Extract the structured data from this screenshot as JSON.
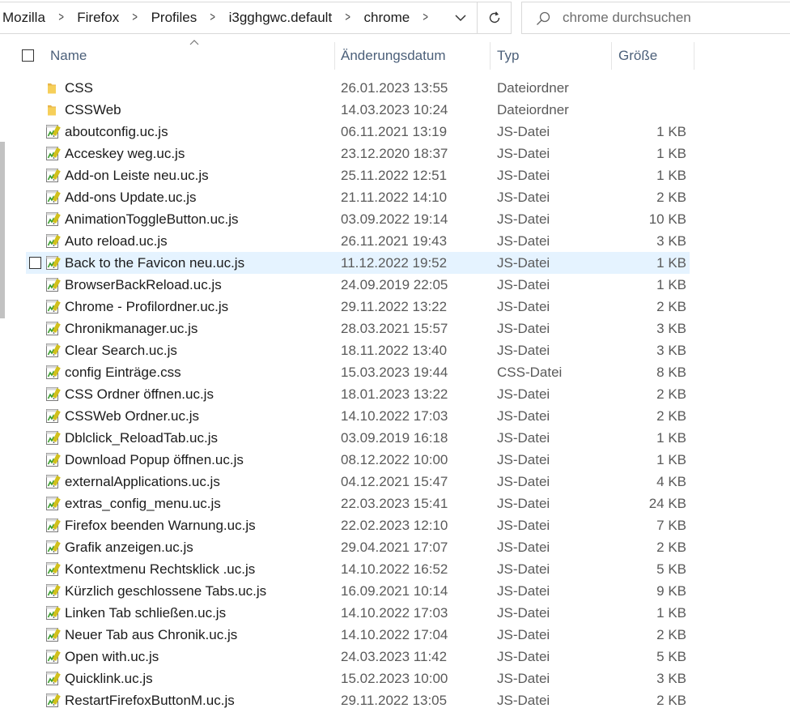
{
  "breadcrumb": [
    "Mozilla",
    "Firefox",
    "Profiles",
    "i3gghgwc.default",
    "chrome"
  ],
  "search": {
    "placeholder": "chrome durchsuchen"
  },
  "columns": {
    "name": "Name",
    "date": "Änderungsdatum",
    "type": "Typ",
    "size": "Größe"
  },
  "files": [
    {
      "name": "CSS",
      "date": "26.01.2023 13:55",
      "type": "Dateiordner",
      "size": "",
      "icon": "folder-icon"
    },
    {
      "name": "CSSWeb",
      "date": "14.03.2023 10:24",
      "type": "Dateiordner",
      "size": "",
      "icon": "folder-icon"
    },
    {
      "name": "aboutconfig.uc.js",
      "date": "06.11.2021 13:19",
      "type": "JS-Datei",
      "size": "1 KB",
      "icon": "script-file-icon"
    },
    {
      "name": "Acceskey weg.uc.js",
      "date": "23.12.2020 18:37",
      "type": "JS-Datei",
      "size": "1 KB",
      "icon": "script-file-icon"
    },
    {
      "name": "Add-on Leiste neu.uc.js",
      "date": "25.11.2022 12:51",
      "type": "JS-Datei",
      "size": "1 KB",
      "icon": "script-file-icon"
    },
    {
      "name": "Add-ons Update.uc.js",
      "date": "21.11.2022 14:10",
      "type": "JS-Datei",
      "size": "2 KB",
      "icon": "script-file-icon"
    },
    {
      "name": "AnimationToggleButton.uc.js",
      "date": "03.09.2022 19:14",
      "type": "JS-Datei",
      "size": "10 KB",
      "icon": "script-file-icon"
    },
    {
      "name": "Auto reload.uc.js",
      "date": "26.11.2021 19:43",
      "type": "JS-Datei",
      "size": "3 KB",
      "icon": "script-file-icon"
    },
    {
      "name": "Back to the Favicon neu.uc.js",
      "date": "11.12.2022 19:52",
      "type": "JS-Datei",
      "size": "1 KB",
      "icon": "script-file-icon",
      "hovered": true
    },
    {
      "name": "BrowserBackReload.uc.js",
      "date": "24.09.2019 22:05",
      "type": "JS-Datei",
      "size": "1 KB",
      "icon": "script-file-icon"
    },
    {
      "name": "Chrome - Profilordner.uc.js",
      "date": "29.11.2022 13:22",
      "type": "JS-Datei",
      "size": "2 KB",
      "icon": "script-file-icon"
    },
    {
      "name": "Chronikmanager.uc.js",
      "date": "28.03.2021 15:57",
      "type": "JS-Datei",
      "size": "3 KB",
      "icon": "script-file-icon"
    },
    {
      "name": "Clear Search.uc.js",
      "date": "18.11.2022 13:40",
      "type": "JS-Datei",
      "size": "3 KB",
      "icon": "script-file-icon"
    },
    {
      "name": "config Einträge.css",
      "date": "15.03.2023 19:44",
      "type": "CSS-Datei",
      "size": "8 KB",
      "icon": "script-file-icon"
    },
    {
      "name": "CSS Ordner öffnen.uc.js",
      "date": "18.01.2023 13:22",
      "type": "JS-Datei",
      "size": "2 KB",
      "icon": "script-file-icon"
    },
    {
      "name": "CSSWeb Ordner.uc.js",
      "date": "14.10.2022 17:03",
      "type": "JS-Datei",
      "size": "2 KB",
      "icon": "script-file-icon"
    },
    {
      "name": "Dblclick_ReloadTab.uc.js",
      "date": "03.09.2019 16:18",
      "type": "JS-Datei",
      "size": "1 KB",
      "icon": "script-file-icon"
    },
    {
      "name": "Download Popup öffnen.uc.js",
      "date": "08.12.2022 10:00",
      "type": "JS-Datei",
      "size": "1 KB",
      "icon": "script-file-icon"
    },
    {
      "name": "externalApplications.uc.js",
      "date": "04.12.2021 15:47",
      "type": "JS-Datei",
      "size": "4 KB",
      "icon": "script-file-icon"
    },
    {
      "name": "extras_config_menu.uc.js",
      "date": "22.03.2023 15:41",
      "type": "JS-Datei",
      "size": "24 KB",
      "icon": "script-file-icon"
    },
    {
      "name": "Firefox beenden Warnung.uc.js",
      "date": "22.02.2023 12:10",
      "type": "JS-Datei",
      "size": "7 KB",
      "icon": "script-file-icon"
    },
    {
      "name": "Grafik anzeigen.uc.js",
      "date": "29.04.2021 17:07",
      "type": "JS-Datei",
      "size": "2 KB",
      "icon": "script-file-icon"
    },
    {
      "name": "Kontextmenu Rechtsklick .uc.js",
      "date": "14.10.2022 16:52",
      "type": "JS-Datei",
      "size": "5 KB",
      "icon": "script-file-icon"
    },
    {
      "name": "Kürzlich geschlossene Tabs.uc.js",
      "date": "16.09.2021 10:14",
      "type": "JS-Datei",
      "size": "9 KB",
      "icon": "script-file-icon"
    },
    {
      "name": "Linken Tab schließen.uc.js",
      "date": "14.10.2022 17:03",
      "type": "JS-Datei",
      "size": "1 KB",
      "icon": "script-file-icon"
    },
    {
      "name": "Neuer Tab aus Chronik.uc.js",
      "date": "14.10.2022 17:04",
      "type": "JS-Datei",
      "size": "2 KB",
      "icon": "script-file-icon"
    },
    {
      "name": "Open with.uc.js",
      "date": "24.03.2023 11:42",
      "type": "JS-Datei",
      "size": "5 KB",
      "icon": "script-file-icon"
    },
    {
      "name": "Quicklink.uc.js",
      "date": "15.02.2023 10:00",
      "type": "JS-Datei",
      "size": "3 KB",
      "icon": "script-file-icon"
    },
    {
      "name": "RestartFirefoxButtonM.uc.js",
      "date": "29.11.2022 13:05",
      "type": "JS-Datei",
      "size": "2 KB",
      "icon": "script-file-icon"
    }
  ]
}
